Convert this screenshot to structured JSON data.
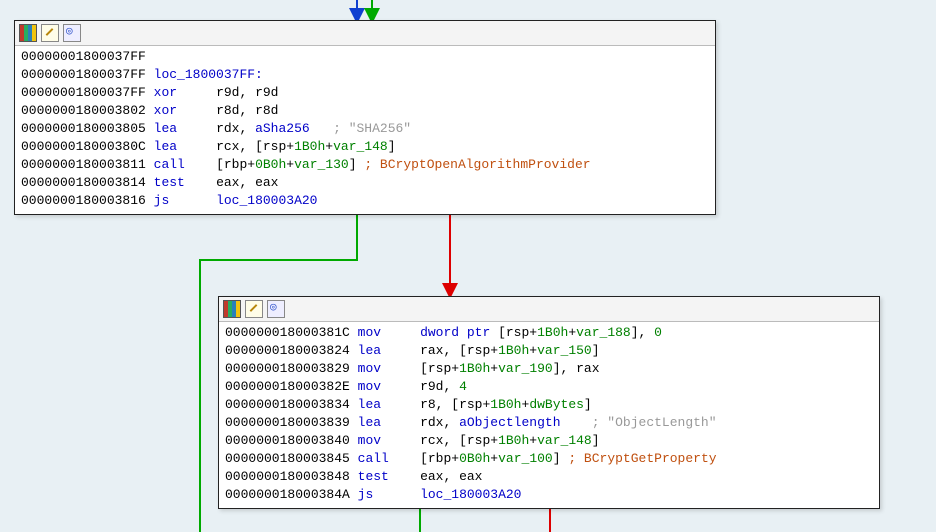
{
  "node1": {
    "title_icons": [
      "color",
      "edit",
      "graph"
    ],
    "lines": [
      {
        "addr": "00000001800037FF",
        "rest": ""
      },
      {
        "addr": "00000001800037FF",
        "label": "loc_1800037FF:"
      },
      {
        "addr": "00000001800037FF",
        "mn": "xor",
        "ops": "r9d, r9d"
      },
      {
        "addr": "0000000180003802",
        "mn": "xor",
        "ops": "r8d, r8d"
      },
      {
        "addr": "0000000180003805",
        "mn": "lea",
        "ops_pre": "rdx, ",
        "sym": "aSha256",
        "cmt": "; \"SHA256\""
      },
      {
        "addr": "000000018000380C",
        "mn": "lea",
        "ops_pre": "rcx, [rsp+",
        "g1": "1B0h",
        "mid1": "+",
        "g2": "var_148",
        "tail": "]"
      },
      {
        "addr": "0000000180003811",
        "mn": "call",
        "ops_pre": "[rbp+",
        "g1": "0B0h",
        "mid1": "+",
        "g2": "var_130",
        "tail": "] ",
        "api": "; BCryptOpenAlgorithmProvider"
      },
      {
        "addr": "0000000180003814",
        "mn": "test",
        "ops": "eax, eax"
      },
      {
        "addr": "0000000180003816",
        "mn": "js",
        "ops_lbl": "loc_180003A20"
      }
    ]
  },
  "node2": {
    "title_icons": [
      "color",
      "edit",
      "graph"
    ],
    "lines": [
      {
        "addr": "000000018000381C",
        "mn": "mov",
        "ops_pre": "",
        "kw": "dword ptr ",
        "mid0": "[rsp+",
        "g1": "1B0h",
        "mid1": "+",
        "g2": "var_188",
        "tail": "], ",
        "num": "0"
      },
      {
        "addr": "0000000180003824",
        "mn": "lea",
        "ops_pre": "rax, [rsp+",
        "g1": "1B0h",
        "mid1": "+",
        "g2": "var_150",
        "tail": "]"
      },
      {
        "addr": "0000000180003829",
        "mn": "mov",
        "ops_pre": "[rsp+",
        "g1": "1B0h",
        "mid1": "+",
        "g2": "var_190",
        "tail": "], rax"
      },
      {
        "addr": "000000018000382E",
        "mn": "mov",
        "ops_pre": "r9d, ",
        "num": "4"
      },
      {
        "addr": "0000000180003834",
        "mn": "lea",
        "ops_pre": "r8, [rsp+",
        "g1": "1B0h",
        "mid1": "+",
        "g2": "dwBytes",
        "tail": "]"
      },
      {
        "addr": "0000000180003839",
        "mn": "lea",
        "ops_pre": "rdx, ",
        "sym": "aObjectlength",
        "cmt": " ; \"ObjectLength\""
      },
      {
        "addr": "0000000180003840",
        "mn": "mov",
        "ops_pre": "rcx, [rsp+",
        "g1": "1B0h",
        "mid1": "+",
        "g2": "var_148",
        "tail": "]"
      },
      {
        "addr": "0000000180003845",
        "mn": "call",
        "ops_pre": "[rbp+",
        "g1": "0B0h",
        "mid1": "+",
        "g2": "var_100",
        "tail": "] ",
        "api": "; BCryptGetProperty"
      },
      {
        "addr": "0000000180003848",
        "mn": "test",
        "ops": "eax, eax"
      },
      {
        "addr": "000000018000384A",
        "mn": "js",
        "ops_lbl": "loc_180003A20"
      }
    ]
  }
}
